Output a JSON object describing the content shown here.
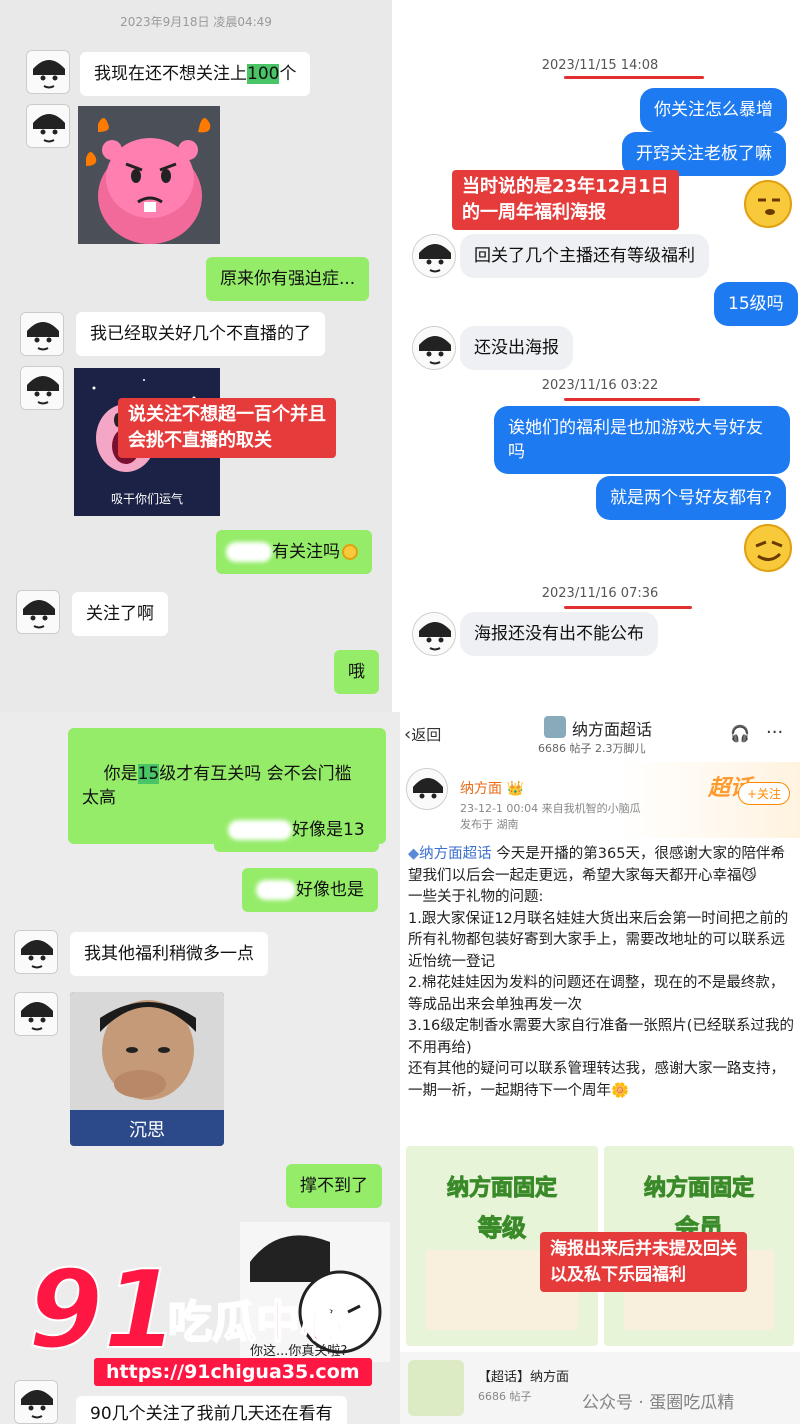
{
  "top_left": {
    "time": "2023年9月18日 凌晨04:49",
    "msg1_before": "我现在还不想关注上",
    "msg1_hl": "100",
    "msg1_after": "个",
    "msg2": "原来你有强迫症...",
    "msg3": "我已经取关好几个不直播的了",
    "sticker_caption": "吸干你们运气",
    "note": "说关注不想超一百个并且\n会挑不直播的取关",
    "msg4": "有关注吗",
    "msg5": "关注了啊",
    "msg6": "哦"
  },
  "top_right": {
    "time1": "2023/11/15 14:08",
    "out1": "你关注怎么暴增",
    "out2": "开窍关注老板了嘛",
    "note": "当时说的是23年12月1日\n的一周年福利海报",
    "in1": "回关了几个主播还有等级福利",
    "out3": "15级吗",
    "in2": "还没出海报",
    "time2": "2023/11/16 03:22",
    "out4": "诶她们的福利是也加游戏大号好友\n吗",
    "out5": "就是两个号好友都有?",
    "time3": "2023/11/16 07:36",
    "in3": "海报还没有出不能公布"
  },
  "bottom_left": {
    "msg1_before": "你是",
    "msg1_hl": "15",
    "msg1_after": "级才有互关吗 会不会门槛\n太高",
    "msg2": "好像是13",
    "msg3": "好像也是",
    "msg4": "我其他福利稍微多一点",
    "photo_caption": "沉思",
    "msg5": "撑不到了",
    "sticker_text": "你这...你真关啦?",
    "msg6": "90几个关注了我前几天还在看有"
  },
  "bottom_right": {
    "back": "返回",
    "title": "纳方面超话",
    "stats": "6686 帖子 2.3万脚儿",
    "author": "纳方面",
    "post_meta": "23-12-1 00:04  来自我机智的小脑瓜",
    "location": "发布于 湖南",
    "follow_btn": "+关注",
    "chaohua_badge": "超话",
    "body_tag": "纳方面超话",
    "body": [
      "今天是开播的第365天，很感谢大家的陪伴希望我们以后会一起走更远，希望大家每天都开心幸福",
      "一些关于礼物的问题:",
      "1.跟大家保证12月联名娃娃大货出来后会第一时间把之前的所有礼物都包装好寄到大家手上，需要改地址的可以联系远近怡统一登记",
      "2.棉花娃娃因为发料的问题还在调整，现在的不是最终款，等成品出来会单独再发一次",
      "3.16级定制香水需要大家自行准备一张照片(已经联系过我的不用再给)",
      "还有其他的疑问可以联系管理转达我，感谢大家一路支持，一期一祈，一起期待下一个周年"
    ],
    "poster1_title": "纳方面固定",
    "poster1_sub": "等级",
    "poster2_title": "纳方面固定",
    "poster2_sub": "会员",
    "note": "海报出来后并未提及回关\n以及私下乐园福利",
    "footer_title": "【超话】纳方面",
    "footer_stats": "6686 帖子",
    "footer_wm": "公众号 · 蛋圈吃瓜精"
  },
  "watermark": {
    "big": "91",
    "text": "吃瓜中心",
    "url": "https://91chigua35.com"
  }
}
